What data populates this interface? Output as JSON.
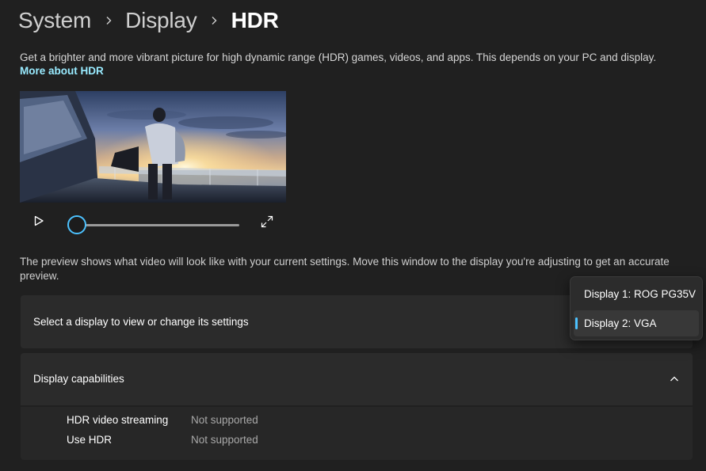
{
  "breadcrumb": {
    "items": [
      "System",
      "Display",
      "HDR"
    ]
  },
  "description": "Get a brighter and more vibrant picture for high dynamic range (HDR) games, videos, and apps. This depends on your PC and display.",
  "more_link": "More about HDR",
  "video_player": {
    "seek_progress": 0
  },
  "preview_note": "The preview shows what video will look like with your current settings. Move this window to the display you're adjusting to get an accurate preview.",
  "display_select": {
    "label": "Select a display to view or change its settings",
    "options": [
      "Display 1: ROG PG35V",
      "Display 2: VGA"
    ],
    "selected": "Display 2: VGA"
  },
  "capabilities": {
    "title": "Display capabilities",
    "rows": [
      {
        "key": "HDR video streaming",
        "value": "Not supported"
      },
      {
        "key": "Use HDR",
        "value": "Not supported"
      }
    ]
  },
  "colors": {
    "accent": "#4cc2ff",
    "link": "#99ebff",
    "background": "#202020",
    "card": "#2b2b2b"
  },
  "icons": [
    "chevron-right-icon",
    "play-icon",
    "expand-icon",
    "chevron-up-icon"
  ]
}
